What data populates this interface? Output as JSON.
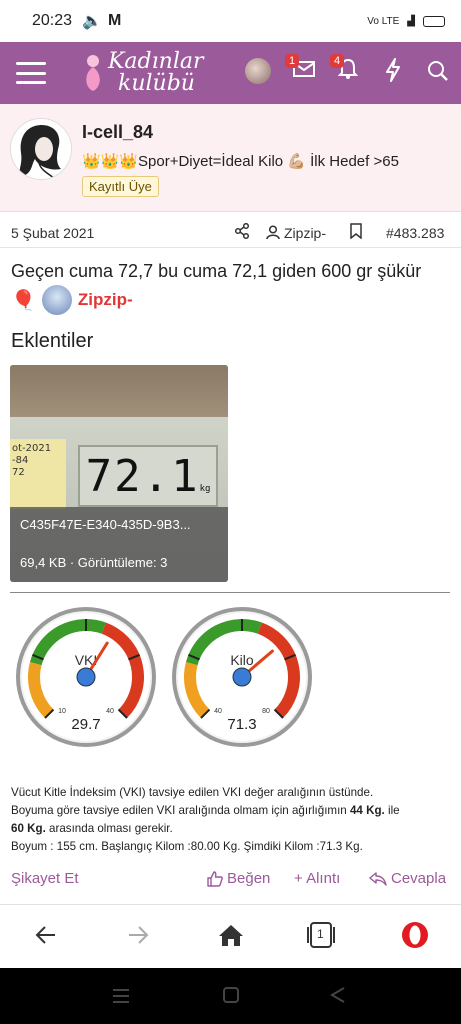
{
  "status": {
    "time": "20:23",
    "battery": "4.5"
  },
  "header": {
    "logo_line1": "Kadınlar",
    "logo_line2": "kulübü",
    "msg_badge": "1",
    "alert_badge": "4"
  },
  "profile": {
    "username": "I-cell_84",
    "title": "👑👑👑Spor+Diyet=İdeal Kilo 💪🏼 İlk Hedef >65",
    "rank": "Kayıtlı Üye"
  },
  "post": {
    "date": "5 Şubat 2021",
    "author": "Zipzip-",
    "number": "#483.283",
    "text": "Geçen cuma 72,7 bu cuma 72,1 giden 600 gr şükür",
    "balloon": "🎈",
    "mention": "Zipzip-",
    "attachments_heading": "Eklentiler",
    "attachment": {
      "note_text": "ot-2021\n-84\n72",
      "display": "72.1",
      "unit": "kg",
      "filename": "C435F47E-E340-435D-9B3...",
      "meta": "69,4 KB · Görüntüleme: 3"
    }
  },
  "gauges": [
    {
      "label": "VKI",
      "value": "29.7",
      "min": "10",
      "max": "40",
      "value_num": 29.7,
      "min_num": 10,
      "max_num": 40
    },
    {
      "label": "Kilo",
      "value": "71.3",
      "min": "40",
      "max": "80",
      "value_num": 71.3,
      "min_num": 40,
      "max_num": 80
    }
  ],
  "vki_text": {
    "line1": "Vücut Kitle İndeksim (VKI) tavsiye edilen VKI değer aralığının üstünde.",
    "line2a": "Boyuma göre tavsiye edilen VKI aralığında olmam için ağırlığımın ",
    "line2b": "44 Kg.",
    "line2c": " ile",
    "line3a": "60 Kg.",
    "line3b": " arasında olması gerekir.",
    "line4": "Boyum : 155 cm. Başlangıç Kilom :80.00 Kg. Şimdiki Kilom :71.3 Kg."
  },
  "actions": {
    "report": "Şikayet Et",
    "like": "Beğen",
    "quote": "+ Alıntı",
    "reply": "Cevapla"
  },
  "bottom_nav": {
    "tab_count": "1"
  },
  "colors": {
    "brand": "#9b5a9a",
    "green": "#3a9a2a",
    "red": "#d93a1f",
    "orange": "#f0a020",
    "needle": "#e0421a",
    "hub": "#3a7bd5"
  }
}
